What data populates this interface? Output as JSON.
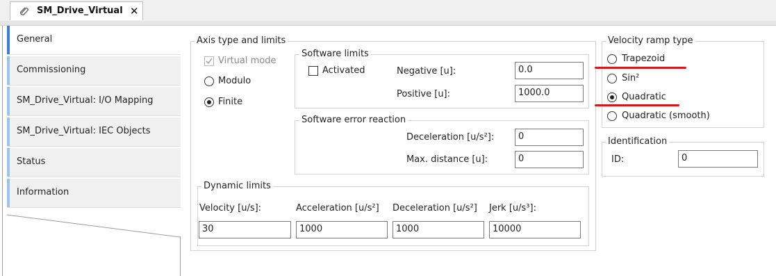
{
  "tab": {
    "title": "SM_Drive_Virtual",
    "close": "✕",
    "icon": "paperclip-icon"
  },
  "sidebar": {
    "items": [
      {
        "label": "General"
      },
      {
        "label": "Commissioning"
      },
      {
        "label": "SM_Drive_Virtual: I/O Mapping"
      },
      {
        "label": "SM_Drive_Virtual: IEC Objects"
      },
      {
        "label": "Status"
      },
      {
        "label": "Information"
      }
    ]
  },
  "axis": {
    "title": "Axis type and limits",
    "virtual_mode": "Virtual mode",
    "modulo": "Modulo",
    "finite": "Finite",
    "selected": "Finite"
  },
  "software_limits": {
    "title": "Software limits",
    "activated": "Activated",
    "negative_label": "Negative [u]:",
    "negative_value": "0.0",
    "positive_label": "Positive [u]:",
    "positive_value": "1000.0"
  },
  "error_reaction": {
    "title": "Software error reaction",
    "decel_label": "Deceleration [u/s²]:",
    "decel_value": "0",
    "maxdist_label": "Max. distance [u]:",
    "maxdist_value": "0"
  },
  "dynamic": {
    "title": "Dynamic limits",
    "velocity_label": "Velocity [u/s]:",
    "velocity_value": "30",
    "accel_label": "Acceleration [u/s²]",
    "accel_value": "1000",
    "decel_label": "Deceleration [u/s²]",
    "decel_value": "1000",
    "jerk_label": "Jerk [u/s³]:",
    "jerk_value": "10000"
  },
  "ramp": {
    "title": "Velocity ramp type",
    "options": [
      "Trapezoid",
      "Sin²",
      "Quadratic",
      "Quadratic (smooth)"
    ],
    "selected": "Quadratic",
    "highlight_color": "#d8161b"
  },
  "identification": {
    "title": "Identification",
    "id_label": "ID:",
    "id_value": "0"
  }
}
